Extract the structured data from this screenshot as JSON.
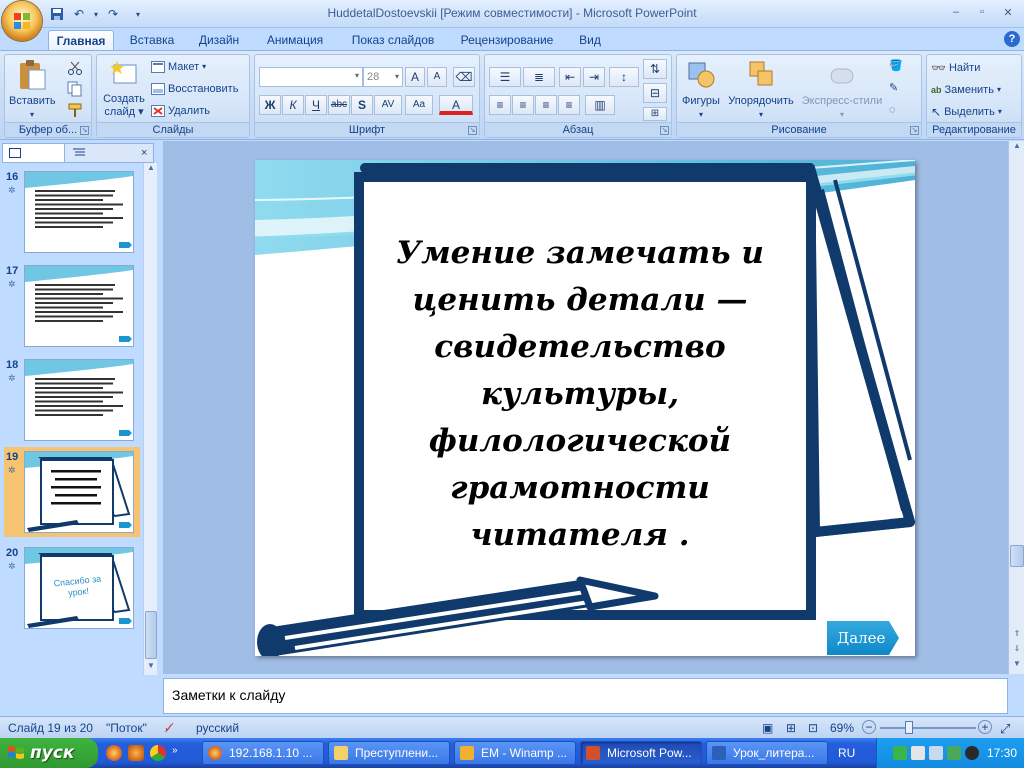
{
  "window": {
    "title": "HuddetalDostoevskii [Режим совместимости] - Microsoft PowerPoint",
    "minimize": "–",
    "restore": "▫",
    "close": "✕"
  },
  "qat": {
    "save": "💾",
    "undo": "↶",
    "redo": "↷"
  },
  "tabs": [
    "Главная",
    "Вставка",
    "Дизайн",
    "Анимация",
    "Показ слайдов",
    "Рецензирование",
    "Вид"
  ],
  "active_tab": "Главная",
  "ribbon": {
    "clipboard": {
      "label": "Буфер об...",
      "paste": "Вставить",
      "cut_icon": "scissors-icon",
      "copy_icon": "copy-icon",
      "format_painter_icon": "brush-icon"
    },
    "slides": {
      "label": "Слайды",
      "new_slide_line1": "Создать",
      "new_slide_line2": "слайд",
      "layout": "Макет",
      "reset": "Восстановить",
      "delete": "Удалить"
    },
    "font": {
      "label": "Шрифт",
      "font_name": "",
      "font_size": "28",
      "bold": "Ж",
      "italic": "К",
      "underline": "Ч",
      "strike": "abc",
      "shadow": "S",
      "spacing": "AV",
      "case": "Aa",
      "color": "A",
      "grow": "A",
      "shrink": "A"
    },
    "paragraph": {
      "label": "Абзац"
    },
    "drawing": {
      "label": "Рисование",
      "shapes": "Фигуры",
      "arrange": "Упорядочить",
      "quick_styles": "Экспресс-стили"
    },
    "editing": {
      "label": "Редактирование",
      "find": "Найти",
      "replace": "Заменить",
      "select": "Выделить"
    }
  },
  "thumbnails": [
    {
      "num": "16",
      "selected": false,
      "kind": "text"
    },
    {
      "num": "17",
      "selected": false,
      "kind": "text"
    },
    {
      "num": "18",
      "selected": false,
      "kind": "text"
    },
    {
      "num": "19",
      "selected": true,
      "kind": "notebook"
    },
    {
      "num": "20",
      "selected": false,
      "kind": "thanks"
    }
  ],
  "thumb20_text": "Спасибо  за урок!",
  "slide": {
    "lines": [
      "Умение замечать и",
      "ценить детали —",
      "свидетельство культуры,",
      "филологической",
      "грамотности читателя ."
    ],
    "next_button": "Далее"
  },
  "notes_placeholder": "Заметки к слайду",
  "status": {
    "slide_info": "Слайд 19 из 20",
    "theme": "\"Поток\"",
    "language": "русский",
    "zoom": "69%"
  },
  "taskbar": {
    "start": "пуск",
    "tasks": [
      "192.168.1.10 ...",
      "Преступлени...",
      "EM - Winamp ...",
      "Microsoft Pow...",
      "Урок_литера..."
    ],
    "active_task": 3,
    "lang": "RU",
    "clock": "17:30"
  },
  "colors": {
    "ribbon_bg": "#c7dbf6",
    "slide_frame": "#103a6b",
    "accent_teal": "#36b3d6",
    "selected_thumb": "#f6c370",
    "taskbar": "#245edb",
    "start": "#3fb33f"
  }
}
